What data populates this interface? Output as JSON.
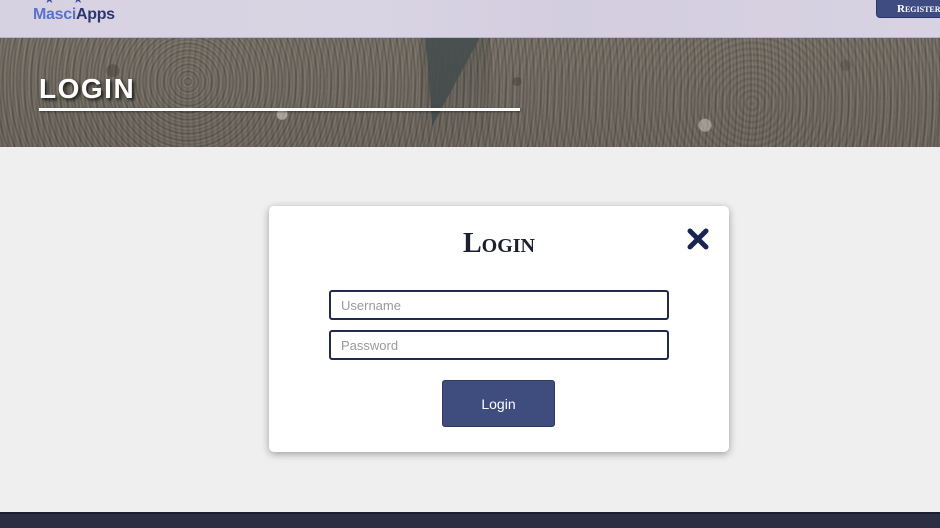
{
  "header": {
    "logo_part1": "Masci",
    "logo_part2": "Apps",
    "register_label": "Register"
  },
  "hero": {
    "title": "LOGIN"
  },
  "modal": {
    "title": "Login",
    "close_icon": "close-icon",
    "username_placeholder": "Username",
    "password_placeholder": "Password",
    "login_label": "Login"
  },
  "colors": {
    "accent": "#3f4c7e",
    "input_border": "#1f2a4e",
    "footer": "#2b2f44"
  }
}
